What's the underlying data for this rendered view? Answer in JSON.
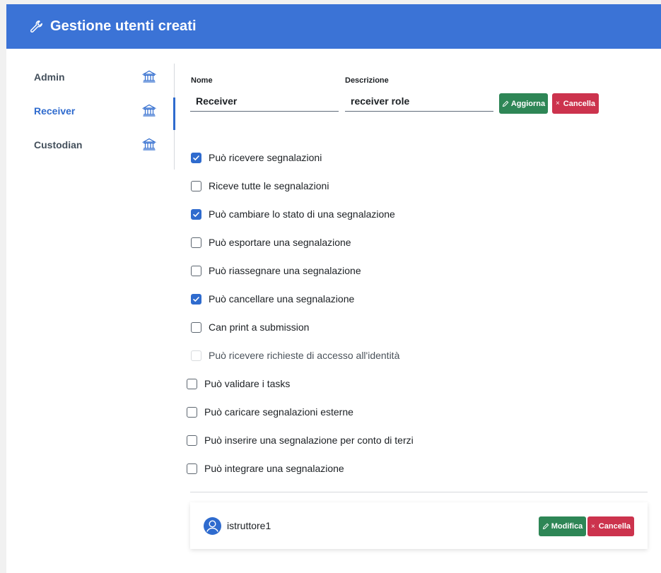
{
  "header": {
    "title": "Gestione utenti creati",
    "icon": "wrench-icon",
    "color": "#3b73d6"
  },
  "sidebar": {
    "items": [
      {
        "label": "Admin",
        "icon": "bank-icon",
        "active": false
      },
      {
        "label": "Receiver",
        "icon": "bank-icon",
        "active": true
      },
      {
        "label": "Custodian",
        "icon": "bank-icon",
        "active": false
      }
    ]
  },
  "form": {
    "name_label": "Nome",
    "name_value": "Receiver",
    "description_label": "Descrizione",
    "description_value": "receiver role",
    "update_label": "Aggiorna",
    "delete_label": "Cancella"
  },
  "permissions": [
    {
      "label": "Può ricevere segnalazioni",
      "checked": true,
      "disabled": false
    },
    {
      "label": "Riceve tutte le segnalazioni",
      "checked": false,
      "disabled": false
    },
    {
      "label": "Può cambiare lo stato di una segnalazione",
      "checked": true,
      "disabled": false
    },
    {
      "label": "Può esportare una segnalazione",
      "checked": false,
      "disabled": false
    },
    {
      "label": "Può riassegnare una segnalazione",
      "checked": false,
      "disabled": false
    },
    {
      "label": "Può cancellare una segnalazione",
      "checked": true,
      "disabled": false
    },
    {
      "label": "Can print a submission",
      "checked": false,
      "disabled": false
    },
    {
      "label": "Può ricevere richieste di accesso all'identità",
      "checked": false,
      "disabled": true
    },
    {
      "label": "Può validare i tasks",
      "checked": false,
      "disabled": false
    },
    {
      "label": "Può caricare segnalazioni esterne",
      "checked": false,
      "disabled": false
    },
    {
      "label": "Può inserire una segnalazione per conto di terzi",
      "checked": false,
      "disabled": false
    },
    {
      "label": "Può integrare una segnalazione",
      "checked": false,
      "disabled": false
    }
  ],
  "user": {
    "name": "istruttore1",
    "avatar_icon": "user-avatar-icon",
    "edit_label": "Modifica",
    "delete_label": "Cancella"
  },
  "colors": {
    "accent": "#2f6bce",
    "success": "#2e8656",
    "danger": "#cc334d"
  }
}
